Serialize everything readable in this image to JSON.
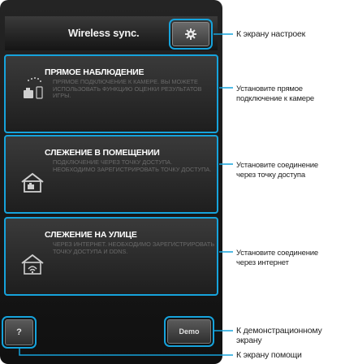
{
  "app": {
    "title": "Wireless sync."
  },
  "cards": [
    {
      "title": "ПРЯМОЕ НАБЛЮДЕНИЕ",
      "desc": "ПРЯМОЕ ПОДКЛЮЧЕНИЕ К КАМЕРЕ. ВЫ МОЖЕТЕ ИСПОЛЬЗОВАТЬ ФУНКЦИЮ ОЦЕНКИ РЕЗУЛЬТАТОВ ИГРЫ."
    },
    {
      "title": "СЛЕЖЕНИЕ В ПОМЕЩЕНИИ",
      "desc": "ПОДКЛЮЧЕНИЕ ЧЕРЕЗ ТОЧКУ ДОСТУПА. НЕОБХОДИМО ЗАРЕГИСТРИРОВАТЬ ТОЧКУ ДОСТУПА."
    },
    {
      "title": "СЛЕЖЕНИЕ НА УЛИЦЕ",
      "desc": "ЧЕРЕЗ ИНТЕРНЕТ. НЕОБХОДИМО ЗАРЕГИСТРИРОВАТЬ ТОЧКУ ДОСТУПА И DDNS."
    }
  ],
  "buttons": {
    "help": "?",
    "demo": "Demo"
  },
  "callouts": {
    "settings": "К экрану настроек",
    "direct_1": "Установите прямое",
    "direct_2": "подключение к камере",
    "indoor_1": "Установите соединение",
    "indoor_2": "через точку доступа",
    "outdoor_1": "Установите соединение",
    "outdoor_2": "через интернет",
    "demo_1": "К демонстрационному",
    "demo_2": "экрану",
    "help": "К экрану помощи"
  },
  "colors": {
    "accent": "#16a3dc",
    "background": "#141414"
  },
  "icons": [
    "gear-icon",
    "camera-phone-icon",
    "house-camera-icon",
    "house-wifi-icon"
  ]
}
